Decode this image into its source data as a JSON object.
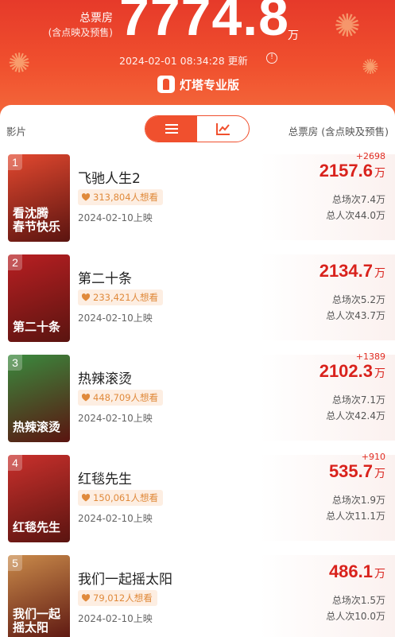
{
  "header": {
    "total_label": "总票房",
    "total_sub": "(含点映及预售)",
    "total_value": "7774.8",
    "total_unit": "万",
    "update_time": "2024-02-01 08:34:28 更新",
    "brand": "灯塔专业版"
  },
  "table": {
    "col_left": "影片",
    "col_right": "总票房 (含点映及预售)",
    "view_modes": [
      "list-icon",
      "chart-icon"
    ]
  },
  "movies": [
    {
      "rank": "1",
      "poster_text": "看沈腾\n春节快乐",
      "title": "飞驰人生2",
      "want": "313,804人想看",
      "release": "2024-02-10上映",
      "delta": "+2698",
      "gross": "2157.6",
      "unit": "万",
      "shows": "总场次7.4万",
      "viewers": "总人次44.0万",
      "poster_color": "#e2482f"
    },
    {
      "rank": "2",
      "poster_text": "第二十条",
      "title": "第二十条",
      "want": "233,421人想看",
      "release": "2024-02-10上映",
      "delta": "",
      "gross": "2134.7",
      "unit": "万",
      "shows": "总场次5.2万",
      "viewers": "总人次43.7万",
      "poster_color": "#b81f22"
    },
    {
      "rank": "3",
      "poster_text": "热辣滚烫",
      "title": "热辣滚烫",
      "want": "448,709人想看",
      "release": "2024-02-10上映",
      "delta": "+1389",
      "gross": "2102.3",
      "unit": "万",
      "shows": "总场次7.1万",
      "viewers": "总人次42.4万",
      "poster_color": "#3a8a3e"
    },
    {
      "rank": "4",
      "poster_text": "红毯先生",
      "title": "红毯先生",
      "want": "150,061人想看",
      "release": "2024-02-10上映",
      "delta": "+910",
      "gross": "535.7",
      "unit": "万",
      "shows": "总场次1.9万",
      "viewers": "总人次11.1万",
      "poster_color": "#c9302c"
    },
    {
      "rank": "5",
      "poster_text": "我们一起摇太阳",
      "title": "我们一起摇太阳",
      "want": "79,012人想看",
      "release": "2024-02-10上映",
      "delta": "",
      "gross": "486.1",
      "unit": "万",
      "shows": "总场次1.5万",
      "viewers": "总人次10.0万",
      "poster_color": "#c98a4a"
    }
  ]
}
